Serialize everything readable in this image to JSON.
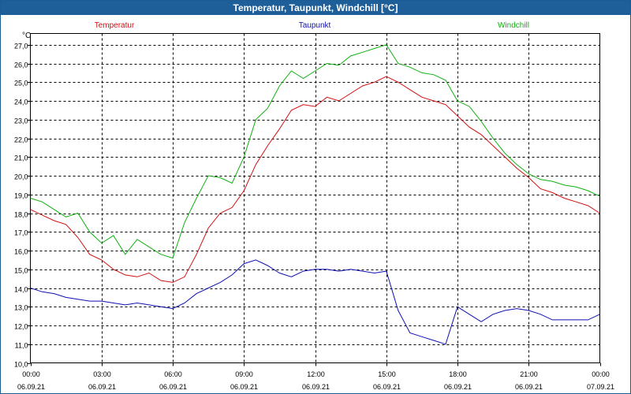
{
  "window": {
    "title": "Temperatur, Taupunkt, Windchill [°C]"
  },
  "chart_data": {
    "type": "line",
    "title": "Temperatur, Taupunkt, Windchill [°C]",
    "ylabel": "°C",
    "ylim": [
      10.0,
      27.6
    ],
    "y_ticks": [
      "10,0",
      "11,0",
      "12,0",
      "13,0",
      "14,0",
      "15,0",
      "16,0",
      "17,0",
      "18,0",
      "19,0",
      "20,0",
      "21,0",
      "22,0",
      "23,0",
      "24,0",
      "25,0",
      "26,0",
      "27,0"
    ],
    "x_ticks": [
      {
        "time": "00:00",
        "date": "06.09.21"
      },
      {
        "time": "03:00",
        "date": "06.09.21"
      },
      {
        "time": "06:00",
        "date": "06.09.21"
      },
      {
        "time": "09:00",
        "date": "06.09.21"
      },
      {
        "time": "12:00",
        "date": "06.09.21"
      },
      {
        "time": "15:00",
        "date": "06.09.21"
      },
      {
        "time": "18:00",
        "date": "06.09.21"
      },
      {
        "time": "21:00",
        "date": "06.09.21"
      },
      {
        "time": "00:00",
        "date": "07.09.21"
      }
    ],
    "xlim_hours": [
      0,
      24
    ],
    "grid": true,
    "legend_placement": "top",
    "series": [
      {
        "name": "Temperatur",
        "color": "#d01010",
        "hours": [
          0,
          0.5,
          1,
          1.5,
          2,
          2.5,
          3,
          3.5,
          4,
          4.5,
          5,
          5.5,
          6,
          6.5,
          7,
          7.5,
          8,
          8.5,
          9,
          9.5,
          10,
          10.5,
          11,
          11.5,
          12,
          12.5,
          13,
          13.5,
          14,
          14.5,
          15,
          15.5,
          16,
          16.5,
          17,
          17.5,
          18,
          18.5,
          19,
          19.5,
          20,
          20.5,
          21,
          21.5,
          22,
          22.5,
          23,
          23.5,
          24
        ],
        "values": [
          18.2,
          17.9,
          17.6,
          17.4,
          16.7,
          15.8,
          15.5,
          15.0,
          14.7,
          14.6,
          14.8,
          14.4,
          14.3,
          14.6,
          15.8,
          17.2,
          18.0,
          18.3,
          19.2,
          20.6,
          21.6,
          22.5,
          23.5,
          23.8,
          23.7,
          24.2,
          24.0,
          24.4,
          24.8,
          25.0,
          25.3,
          25.0,
          24.6,
          24.2,
          24.0,
          23.8,
          23.2,
          22.6,
          22.2,
          21.6,
          21.0,
          20.4,
          19.9,
          19.3,
          19.1,
          18.8,
          18.6,
          18.4,
          18.0
        ]
      },
      {
        "name": "Taupunkt",
        "color": "#1010b0",
        "hours": [
          0,
          0.5,
          1,
          1.5,
          2,
          2.5,
          3,
          3.5,
          4,
          4.5,
          5,
          5.5,
          6,
          6.5,
          7,
          7.5,
          8,
          8.5,
          9,
          9.5,
          10,
          10.5,
          11,
          11.5,
          12,
          12.5,
          13,
          13.5,
          14,
          14.5,
          15,
          15.5,
          16,
          16.5,
          17,
          17.5,
          18,
          18.5,
          19,
          19.5,
          20,
          20.5,
          21,
          21.5,
          22,
          22.5,
          23,
          23.5,
          24
        ],
        "values": [
          14.0,
          13.8,
          13.7,
          13.5,
          13.4,
          13.3,
          13.3,
          13.2,
          13.1,
          13.2,
          13.1,
          13.0,
          12.9,
          13.2,
          13.7,
          14.0,
          14.3,
          14.7,
          15.3,
          15.5,
          15.2,
          14.8,
          14.6,
          14.9,
          15.0,
          15.0,
          14.9,
          15.0,
          14.9,
          14.8,
          14.9,
          12.8,
          11.6,
          11.4,
          11.2,
          11.0,
          13.0,
          12.6,
          12.2,
          12.6,
          12.8,
          12.9,
          12.8,
          12.6,
          12.3,
          12.3,
          12.3,
          12.3,
          12.6
        ]
      },
      {
        "name": "Windchill",
        "color": "#10b010",
        "hours": [
          0,
          0.5,
          1,
          1.5,
          2,
          2.5,
          3,
          3.5,
          4,
          4.5,
          5,
          5.5,
          6,
          6.5,
          7,
          7.5,
          8,
          8.5,
          9,
          9.5,
          10,
          10.5,
          11,
          11.5,
          12,
          12.5,
          13,
          13.5,
          14,
          14.5,
          15,
          15.5,
          16,
          16.5,
          17,
          17.5,
          18,
          18.5,
          19,
          19.5,
          20,
          20.5,
          21,
          21.5,
          22,
          22.5,
          23,
          23.5,
          24
        ],
        "values": [
          18.8,
          18.6,
          18.2,
          17.8,
          18.0,
          17.0,
          16.4,
          16.8,
          15.8,
          16.6,
          16.2,
          15.8,
          15.6,
          17.5,
          18.8,
          20.0,
          19.9,
          19.6,
          21.0,
          23.0,
          23.6,
          24.8,
          25.6,
          25.2,
          25.6,
          26.0,
          25.9,
          26.4,
          26.6,
          26.8,
          27.0,
          26.0,
          25.8,
          25.5,
          25.4,
          25.1,
          24.0,
          23.7,
          22.9,
          22.0,
          21.2,
          20.6,
          20.1,
          19.8,
          19.7,
          19.5,
          19.4,
          19.2,
          18.9
        ]
      }
    ]
  }
}
